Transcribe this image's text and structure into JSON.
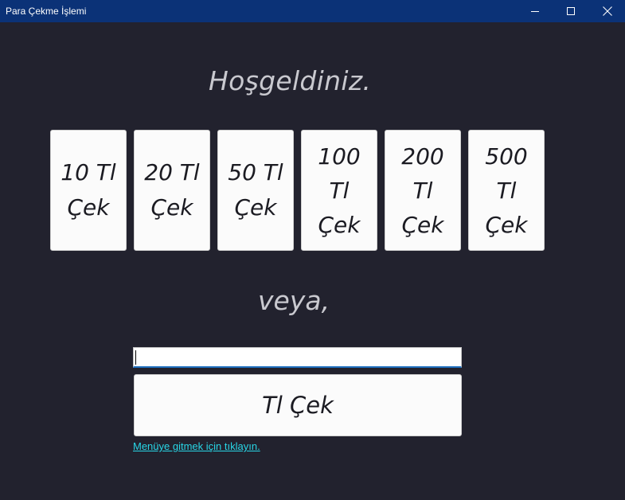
{
  "window": {
    "title": "Para Çekme İşlemi",
    "controls": {
      "minimize": "minimize-icon",
      "maximize": "maximize-icon",
      "close": "close-icon"
    }
  },
  "main": {
    "welcome": "Hoşgeldiniz.",
    "amount_buttons": [
      {
        "label": "10 Tl Çek"
      },
      {
        "label": "20 Tl Çek"
      },
      {
        "label": "50 Tl Çek"
      },
      {
        "label": "100 Tl Çek"
      },
      {
        "label": "200 Tl Çek"
      },
      {
        "label": "500 Tl Çek"
      }
    ],
    "or_text": "veya,",
    "custom_amount": {
      "value": "",
      "placeholder": ""
    },
    "withdraw_button": "Tl Çek",
    "menu_link": "Menüye gitmek için tıklayın."
  },
  "colors": {
    "background": "#22222e",
    "titlebar": "#0b3277",
    "heading_text": "#c9c9cf",
    "button_face": "#fbfbfb",
    "link": "#28d6e6",
    "input_focus": "#1f6fbf"
  }
}
